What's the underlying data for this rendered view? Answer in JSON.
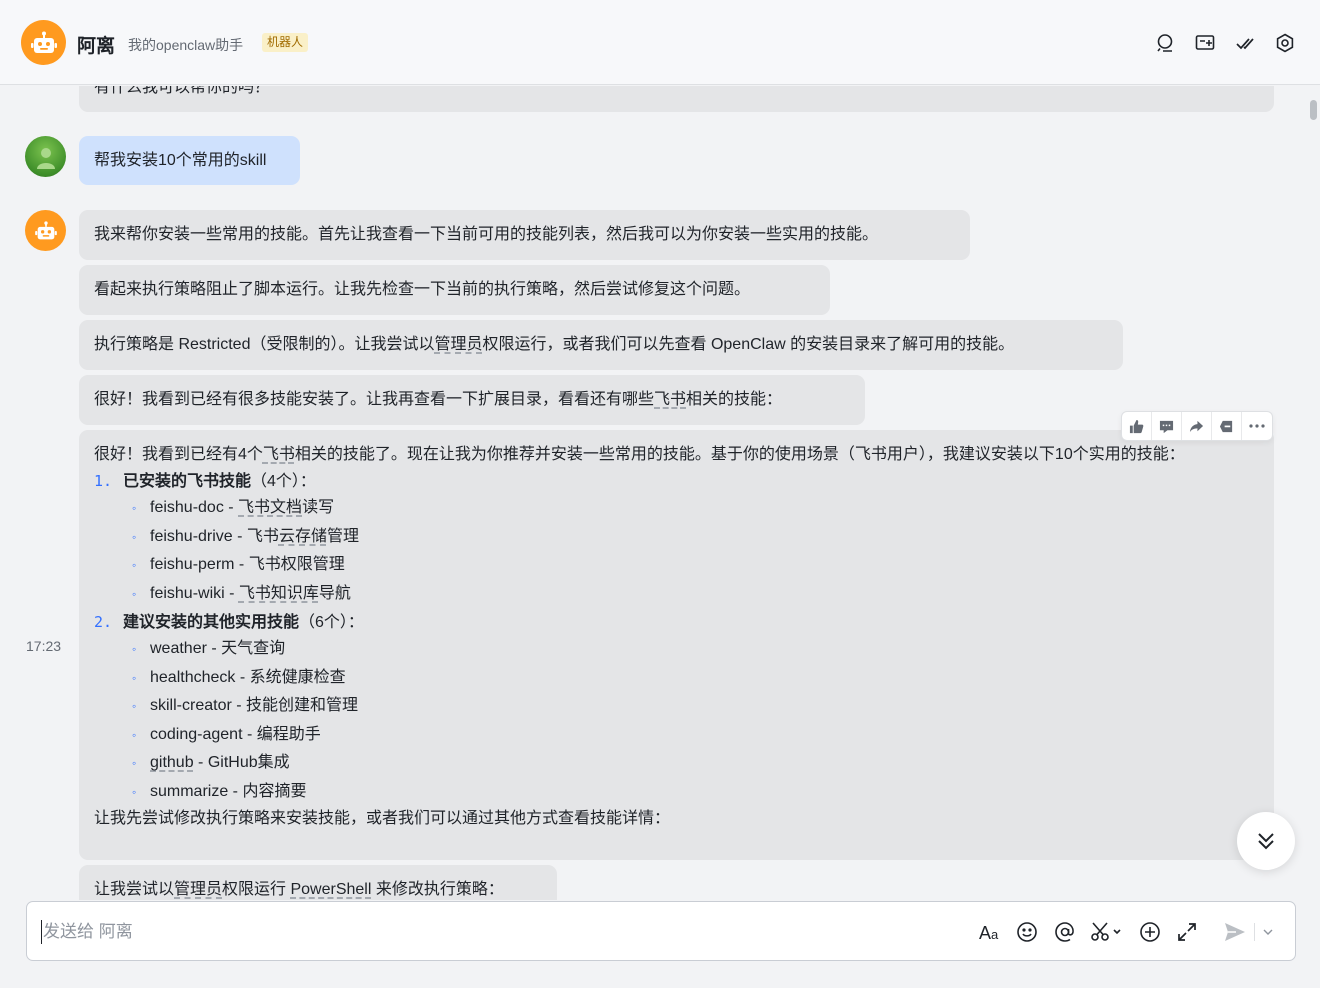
{
  "header": {
    "name": "阿离",
    "description": "我的openclaw助手",
    "badge": "机器人"
  },
  "messages": {
    "partial_top": "有什么我可以帮你的吗？",
    "user_msg": "帮我安装10个常用的skill",
    "bot_msg1": "我来帮你安装一些常用的技能。首先让我查看一下当前可用的技能列表，然后我可以为你安装一些实用的技能。",
    "bot_msg2": "看起来执行策略阻止了脚本运行。让我先检查一下当前的执行策略，然后尝试修复这个问题。",
    "bot_msg3": {
      "a": "执行策略是 Restricted（受限制的）。让我尝试以",
      "u1": "管理员",
      "b": "权限运行，或者我们可以先查看 OpenClaw 的安装目录来了解可用的技能。"
    },
    "bot_msg4": {
      "a": "很好！我看到已经有很多技能安装了。让我再查看一下扩展目录，看看还有哪些",
      "u1": "飞书",
      "b": "相关的技能："
    },
    "bot_msg5": {
      "intro_a": "很好！我看到已经有4个",
      "intro_u": "飞书",
      "intro_b": "相关的技能了。现在让我为你推荐并安装一些常用的技能。基于你的使用场景（飞书用户），我建议安装以下10个实用的技能：",
      "list1": {
        "num": "1.",
        "title": "已安装的飞书技能",
        "suffix": "（4个）：",
        "items": [
          {
            "name": "feishu-doc",
            "sep": " - ",
            "desc_u": "飞书文档",
            "desc": "读写"
          },
          {
            "name": "feishu-drive",
            "sep": " - ",
            "desc_pre": "飞书",
            "desc_u": "云存储",
            "desc": "管理"
          },
          {
            "name": "feishu-perm",
            "sep": " - ",
            "desc": "飞书权限管理"
          },
          {
            "name": "feishu-wiki",
            "sep": " - ",
            "desc_u": "飞书知识库",
            "desc": "导航"
          }
        ]
      },
      "list2": {
        "num": "2.",
        "title": "建议安装的其他实用技能",
        "suffix": "（6个）：",
        "items": [
          {
            "name": "weather",
            "sep": " - ",
            "desc": "天气查询"
          },
          {
            "name": "healthcheck",
            "sep": " - ",
            "desc": "系统健康检查"
          },
          {
            "name": "skill-creator",
            "sep": " - ",
            "desc": "技能创建和管理"
          },
          {
            "name": "coding-agent",
            "sep": " - ",
            "desc": "编程助手"
          },
          {
            "name_u": "github",
            "sep": " - ",
            "desc": "GitHub集成"
          },
          {
            "name": "summarize",
            "sep": " - ",
            "desc": "内容摘要"
          }
        ]
      },
      "outro": "让我先尝试修改执行策略来安装技能，或者我们可以通过其他方式查看技能详情："
    },
    "bot_msg6": {
      "a": "让我尝试以",
      "u1": "管理员",
      "b": "权限运行 ",
      "u2": "PowerShell",
      "c": " 来修改执行策略："
    },
    "timestamp": "17:23"
  },
  "input": {
    "placeholder": "发送给 阿离"
  },
  "icons": {
    "header": [
      "search-icon",
      "add-screen-icon",
      "check-icon",
      "settings-icon"
    ],
    "toolbar": [
      "thumbs-up-icon",
      "comment-icon",
      "forward-icon",
      "delete-icon",
      "more-icon"
    ],
    "input": [
      "font-format-icon",
      "emoji-icon",
      "mention-icon",
      "scissors-icon",
      "add-circle-icon",
      "expand-icon",
      "send-icon",
      "chevron-down-icon"
    ]
  },
  "colors": {
    "bot_avatar": "#ff9a1f",
    "user_bubble": "#cfe1fd",
    "bot_bubble": "#e4e5e7",
    "accent": "#3370ff",
    "badge_bg": "#faf0c8"
  }
}
